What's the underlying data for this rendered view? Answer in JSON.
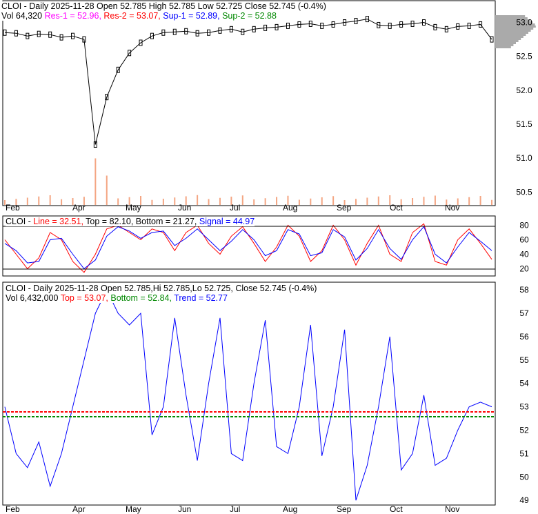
{
  "panel1": {
    "ticker": "CLOI",
    "title": "CLOI - Daily 2025-11-28 Open 52.785  High 52.785  Low 52.725  Close 52.745 (-0.4%)",
    "vol": "Vol 64,320",
    "res1": "Res-1 = 52.96,",
    "res2": "Res-2 = 53.07,",
    "sup1": "Sup-1 = 52.89,",
    "sup2": "Sup-2 = 52.88"
  },
  "panel2": {
    "prefix": "CLOI - ",
    "line": "Line = 32.51,",
    "rest": " Top = 82.10, Bottom = 21.27,",
    "signal": "Signal = 44.97"
  },
  "panel3": {
    "title": "CLOI - Daily 2025-11-28 Open 52.785,Hi 52.785,Lo 52.725, Close 52.745 (-0.4%)",
    "vol": "Vol 6,432,000",
    "top": "Top = 53.07,",
    "bottom": "Bottom = 52.84,",
    "trend": "Trend = 52.77"
  },
  "colors": {
    "res1": "#ff00ff",
    "res2": "#ff0000",
    "sup1": "#0000ff",
    "sup2": "#008000",
    "volume": "#f4a582"
  },
  "chart_data": [
    {
      "type": "line",
      "title": "CLOI Daily price",
      "months": [
        "Feb",
        "Apr",
        "May",
        "Jun",
        "Jul",
        "Aug",
        "Sep",
        "Oct",
        "Nov"
      ],
      "yticks": [
        "53.0",
        "52.5",
        "52.0",
        "51.5",
        "51.0",
        "50.5"
      ],
      "ylim": [
        50.3,
        53.3
      ],
      "close": [
        52.85,
        52.84,
        52.8,
        52.83,
        52.82,
        52.78,
        52.8,
        52.75,
        51.2,
        51.9,
        52.3,
        52.55,
        52.7,
        52.8,
        52.85,
        52.86,
        52.87,
        52.84,
        52.85,
        52.88,
        52.9,
        52.86,
        52.9,
        52.92,
        52.93,
        52.95,
        52.97,
        52.98,
        52.95,
        52.97,
        53.0,
        53.02,
        53.05,
        52.96,
        52.95,
        52.97,
        52.98,
        53.0,
        52.93,
        52.9,
        52.94,
        52.95,
        52.97,
        52.75
      ]
    },
    {
      "type": "line",
      "title": "Stochastic",
      "yticks": [
        "80",
        "60",
        "40",
        "20"
      ],
      "ylim": [
        10,
        90
      ],
      "line": [
        60,
        40,
        20,
        35,
        70,
        60,
        30,
        15,
        40,
        75,
        80,
        70,
        60,
        75,
        70,
        45,
        70,
        80,
        55,
        40,
        65,
        78,
        55,
        30,
        50,
        80,
        65,
        30,
        45,
        80,
        60,
        25,
        55,
        80,
        40,
        30,
        70,
        82,
        30,
        25,
        60,
        75,
        55,
        33
      ],
      "signal": [
        55,
        45,
        28,
        30,
        60,
        62,
        40,
        20,
        32,
        65,
        78,
        72,
        62,
        70,
        72,
        52,
        62,
        75,
        60,
        45,
        58,
        74,
        60,
        38,
        45,
        74,
        68,
        38,
        42,
        74,
        64,
        32,
        48,
        74,
        48,
        33,
        60,
        78,
        40,
        28,
        50,
        70,
        58,
        45
      ]
    },
    {
      "type": "line",
      "title": "Trend",
      "yticks": [
        "58",
        "57",
        "56",
        "55",
        "54",
        "53",
        "52",
        "51",
        "50",
        "49"
      ],
      "ylim": [
        48.8,
        58.3
      ],
      "trend": [
        53,
        51,
        50.4,
        51.5,
        49.6,
        51,
        53,
        55,
        57,
        58,
        57,
        56.5,
        57,
        51.8,
        53,
        56.8,
        53.5,
        50.7,
        54,
        56.8,
        51,
        50.7,
        54,
        56.7,
        51.3,
        51,
        53,
        56.5,
        50.9,
        53,
        56.3,
        49,
        50.5,
        53,
        56,
        50.3,
        51,
        53.5,
        50.5,
        50.8,
        52,
        53,
        53.2,
        53
      ]
    }
  ]
}
